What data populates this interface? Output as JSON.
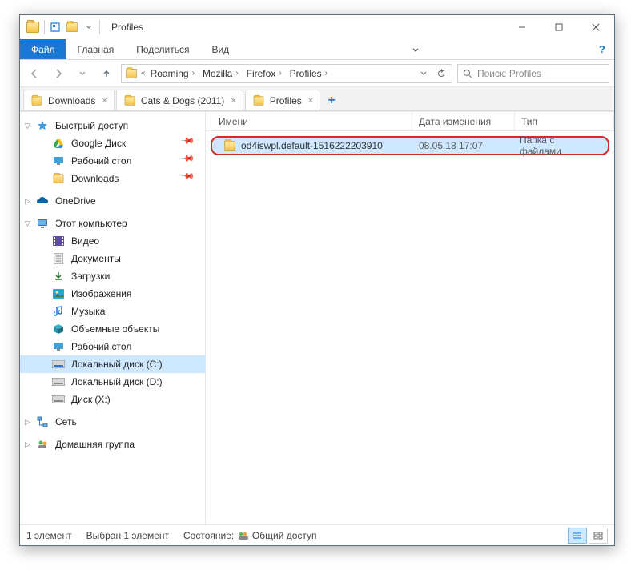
{
  "title": "Profiles",
  "ribbon": {
    "file": "Файл",
    "home": "Главная",
    "share": "Поделиться",
    "view": "Вид"
  },
  "breadcrumbs": [
    "Roaming",
    "Mozilla",
    "Firefox",
    "Profiles"
  ],
  "search": {
    "placeholder": "Поиск: Profiles"
  },
  "doc_tabs": [
    {
      "label": "Downloads"
    },
    {
      "label": "Cats & Dogs (2011)"
    },
    {
      "label": "Profiles",
      "active": true
    }
  ],
  "columns": {
    "name": "Имени",
    "date": "Дата изменения",
    "type": "Тип"
  },
  "rows": [
    {
      "name": "od4iswpl.default-1516222203910",
      "date": "08.05.18 17:07",
      "type": "Папка с файлами"
    }
  ],
  "sidebar": {
    "quick": {
      "label": "Быстрый доступ",
      "items": [
        {
          "label": "Google Диск",
          "icon": "gdrive",
          "pinned": true
        },
        {
          "label": "Рабочий стол",
          "icon": "desktop",
          "pinned": true
        },
        {
          "label": "Downloads",
          "icon": "folder",
          "pinned": true
        }
      ]
    },
    "onedrive": {
      "label": "OneDrive"
    },
    "thispc": {
      "label": "Этот компьютер",
      "items": [
        {
          "label": "Видео",
          "icon": "video"
        },
        {
          "label": "Документы",
          "icon": "docs"
        },
        {
          "label": "Загрузки",
          "icon": "downloads"
        },
        {
          "label": "Изображения",
          "icon": "pictures"
        },
        {
          "label": "Музыка",
          "icon": "music"
        },
        {
          "label": "Объемные объекты",
          "icon": "3d"
        },
        {
          "label": "Рабочий стол",
          "icon": "desktop"
        },
        {
          "label": "Локальный диск (C:)",
          "icon": "drive",
          "selected": true
        },
        {
          "label": "Локальный диск (D:)",
          "icon": "drive"
        },
        {
          "label": "Диск (X:)",
          "icon": "drive"
        }
      ]
    },
    "network": {
      "label": "Сеть"
    },
    "homegroup": {
      "label": "Домашняя группа"
    }
  },
  "status": {
    "count": "1 элемент",
    "selected": "Выбран 1 элемент",
    "state_label": "Состояние:",
    "state_value": "Общий доступ"
  }
}
